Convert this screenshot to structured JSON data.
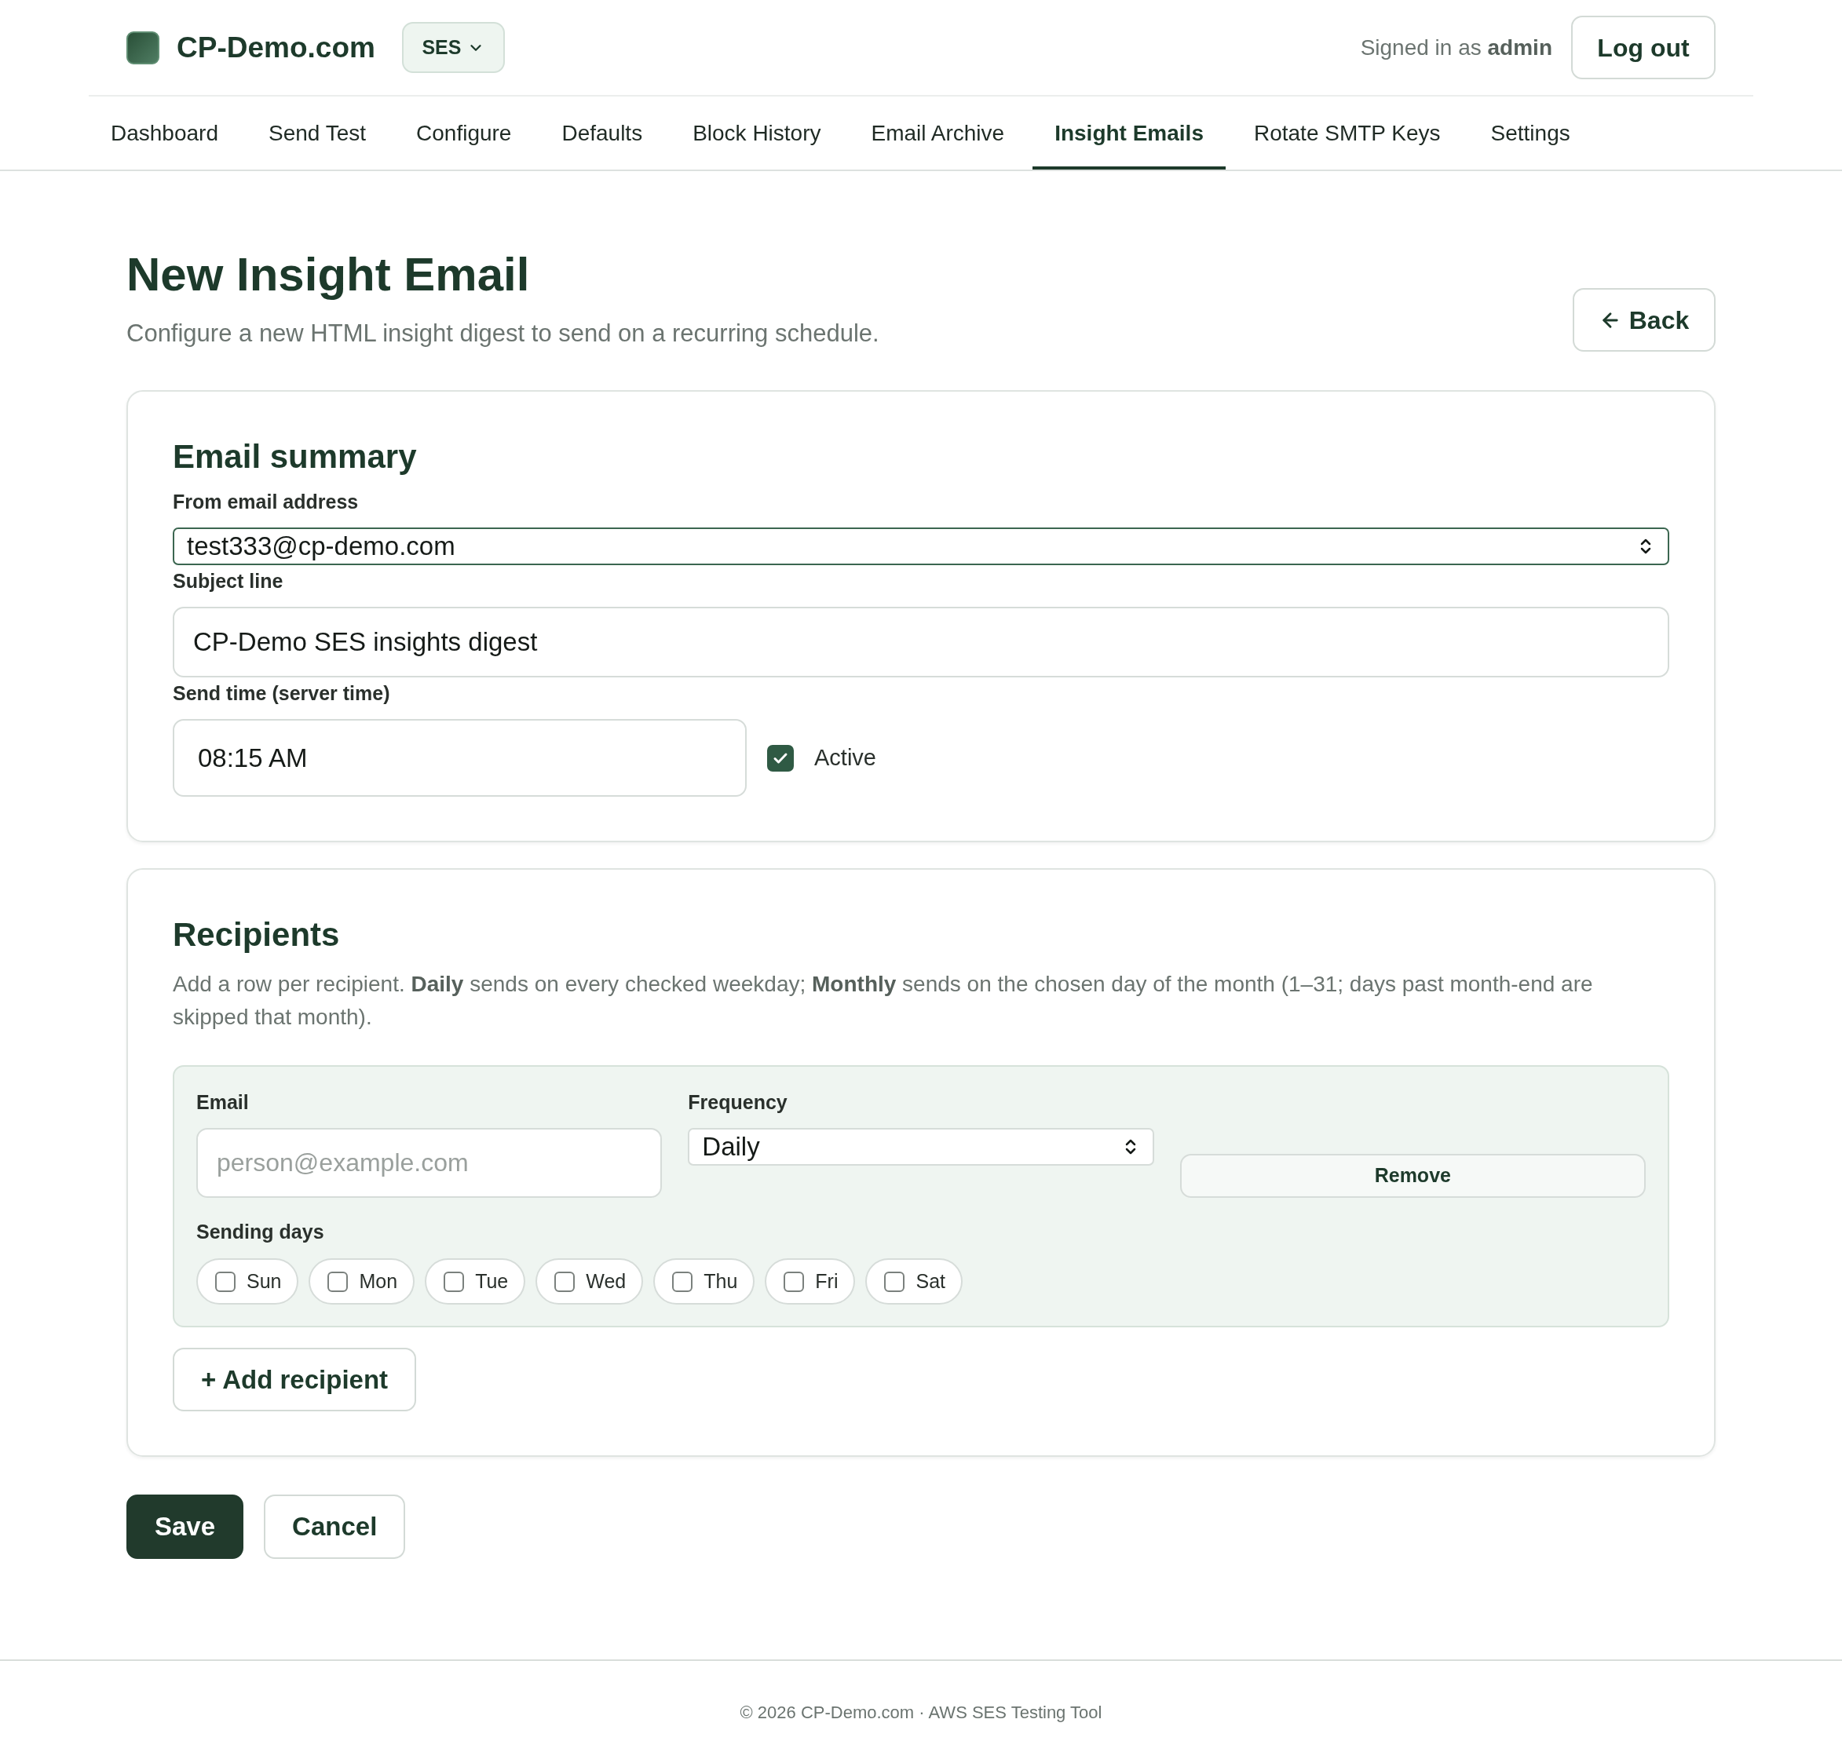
{
  "header": {
    "brand": "CP-Demo.com",
    "service_menu": {
      "label": "SES"
    },
    "signed_in": "Signed in as **admin**",
    "logout_button": "Log out"
  },
  "nav": {
    "tabs": [
      {
        "label": "Dashboard",
        "selected": false
      },
      {
        "label": "Send Test",
        "selected": false
      },
      {
        "label": "Configure",
        "selected": false
      },
      {
        "label": "Defaults",
        "selected": false
      },
      {
        "label": "Block History",
        "selected": false
      },
      {
        "label": "Email Archive",
        "selected": false
      },
      {
        "label": "Insight Emails",
        "selected": true
      },
      {
        "label": "Rotate SMTP Keys",
        "selected": false
      },
      {
        "label": "Settings",
        "selected": false
      }
    ]
  },
  "page": {
    "title": "New Insight Email",
    "subtitle": "Configure a new HTML insight digest to send on a recurring schedule.",
    "back_button": "Back"
  },
  "email_summary": {
    "title": "Email summary",
    "from": {
      "label": "From email address",
      "value": "test333@cp-demo.com"
    },
    "subject": {
      "label": "Subject line",
      "value": "CP-Demo SES insights digest"
    },
    "send_time": {
      "label": "Send time (server time)",
      "value": "08:15 AM"
    },
    "active": {
      "label": "Active",
      "checked": true
    }
  },
  "recipients": {
    "title": "Recipients",
    "description": "Add a row per recipient. **Daily** sends on every checked weekday; **Monthly** sends on the chosen day of the month (1–31; days past month-end are skipped that month).",
    "rows": [
      {
        "email": {
          "label": "Email",
          "placeholder": "person@example.com"
        },
        "frequency": {
          "label": "Frequency",
          "value": "Daily"
        },
        "remove_button": "Remove",
        "days_label": "Sending days",
        "days": [
          {
            "label": "Sun",
            "checked": false
          },
          {
            "label": "Mon",
            "checked": false
          },
          {
            "label": "Tue",
            "checked": false
          },
          {
            "label": "Wed",
            "checked": false
          },
          {
            "label": "Thu",
            "checked": false
          },
          {
            "label": "Fri",
            "checked": false
          },
          {
            "label": "Sat",
            "checked": false
          }
        ]
      }
    ],
    "add_button": "+ Add recipient"
  },
  "actions": [
    {
      "label": "Save",
      "kind": "primary"
    },
    {
      "label": "Cancel",
      "kind": "secondary"
    }
  ],
  "footer": {
    "text": "© 2026 CP-Demo.com · AWS SES Testing Tool"
  }
}
